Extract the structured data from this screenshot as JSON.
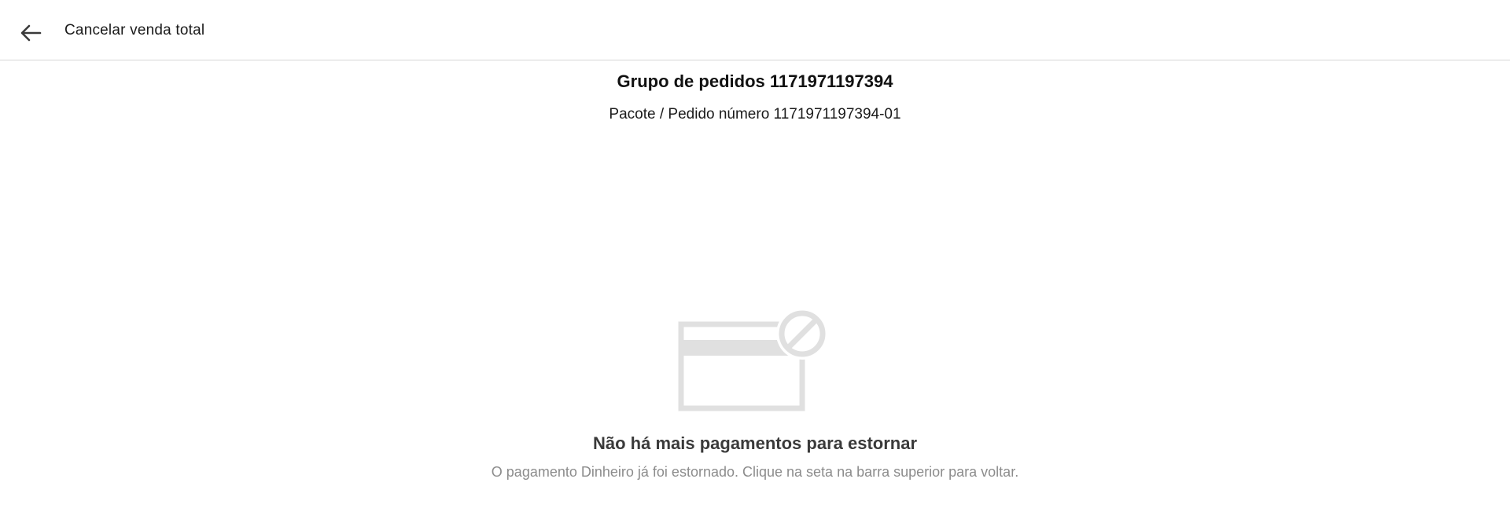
{
  "header": {
    "back_icon": "arrow-left-icon",
    "title": "Cancelar venda total"
  },
  "order": {
    "group_title": "Grupo de pedidos 1171971197394",
    "package_subtitle": "Pacote / Pedido número 1171971197394-01"
  },
  "empty_state": {
    "icon": "card-blocked-icon",
    "title": "Não há mais pagamentos para estornar",
    "description": "O pagamento Dinheiro já foi estornado. Clique na seta na barra superior para voltar."
  },
  "colors": {
    "illustration": "#e0e0e0",
    "divider": "#d6d6d6",
    "muted_text": "#8c8c8c"
  }
}
